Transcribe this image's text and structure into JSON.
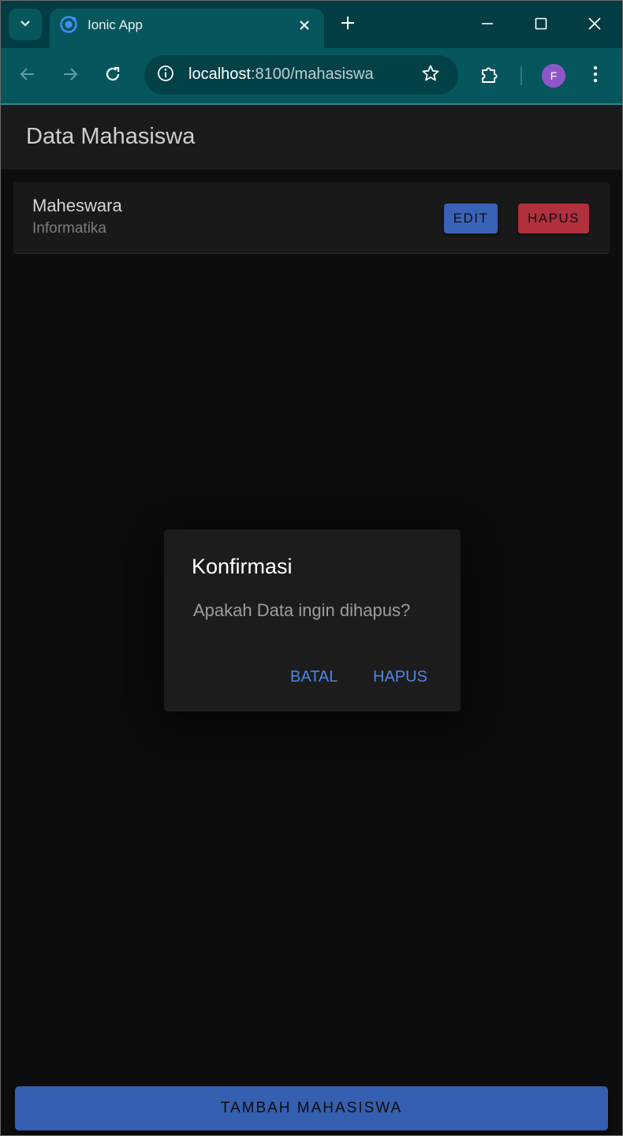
{
  "browser": {
    "tab_title": "Ionic App",
    "url_host": "localhost",
    "url_rest": ":8100/mahasiswa",
    "profile_initial": "F"
  },
  "app": {
    "header_title": "Data Mahasiswa",
    "students": [
      {
        "name": "Maheswara",
        "major": "Informatika",
        "edit_label": "EDIT",
        "delete_label": "HAPUS"
      }
    ],
    "add_button_label": "TAMBAH MAHASISWA"
  },
  "alert": {
    "title": "Konfirmasi",
    "message": "Apakah Data ingin dihapus?",
    "cancel_label": "BATAL",
    "confirm_label": "HAPUS"
  },
  "colors": {
    "primary": "#3a63b8",
    "danger": "#b0303d",
    "alert_button": "#4d86e8",
    "browser_frame": "#05575d"
  }
}
